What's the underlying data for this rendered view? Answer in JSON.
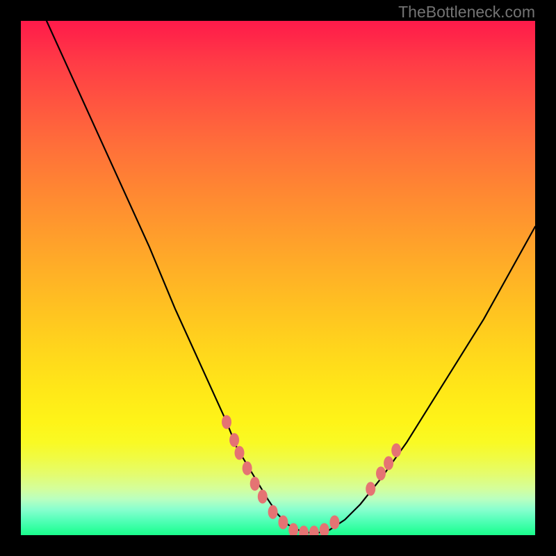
{
  "attribution": "TheBottleneck.com",
  "colors": {
    "marker": "#e57373",
    "curve": "#000000"
  },
  "chart_data": {
    "type": "line",
    "title": "",
    "xlabel": "",
    "ylabel": "",
    "xlim": [
      0,
      100
    ],
    "ylim": [
      0,
      100
    ],
    "series": [
      {
        "name": "curve",
        "x": [
          5,
          10,
          15,
          20,
          25,
          30,
          35,
          40,
          42,
          45,
          48,
          50,
          52,
          55,
          58,
          60,
          63,
          66,
          70,
          75,
          80,
          85,
          90,
          95,
          100
        ],
        "y": [
          100,
          89,
          78,
          67,
          56,
          44,
          33,
          22,
          17,
          12,
          7,
          4,
          2,
          0.5,
          0.5,
          1,
          3,
          6,
          11,
          18,
          26,
          34,
          42,
          51,
          60
        ]
      }
    ],
    "markers": [
      {
        "x": 40,
        "y": 22
      },
      {
        "x": 41.5,
        "y": 18.5
      },
      {
        "x": 42.5,
        "y": 16
      },
      {
        "x": 44,
        "y": 13
      },
      {
        "x": 45.5,
        "y": 10
      },
      {
        "x": 47,
        "y": 7.5
      },
      {
        "x": 49,
        "y": 4.5
      },
      {
        "x": 51,
        "y": 2.5
      },
      {
        "x": 53,
        "y": 1
      },
      {
        "x": 55,
        "y": 0.5
      },
      {
        "x": 57,
        "y": 0.5
      },
      {
        "x": 59,
        "y": 1
      },
      {
        "x": 61,
        "y": 2.5
      },
      {
        "x": 68,
        "y": 9
      },
      {
        "x": 70,
        "y": 12
      },
      {
        "x": 71.5,
        "y": 14
      },
      {
        "x": 73,
        "y": 16.5
      }
    ]
  }
}
